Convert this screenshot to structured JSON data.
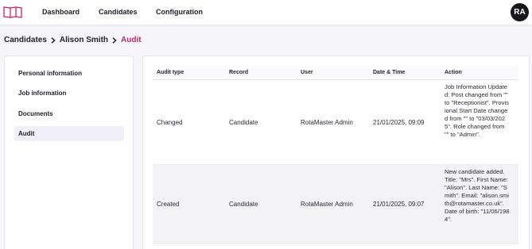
{
  "nav": {
    "items": [
      "Dashboard",
      "Candidates",
      "Configuration"
    ],
    "avatar_initials": "RA"
  },
  "breadcrumb": [
    "Candidates",
    "Alison Smith",
    "Audit"
  ],
  "sidebar": {
    "items": [
      {
        "label": "Personal information",
        "active": false
      },
      {
        "label": "Job information",
        "active": false
      },
      {
        "label": "Documents",
        "active": false
      },
      {
        "label": "Audit",
        "active": true
      }
    ]
  },
  "audit_table": {
    "headers": [
      "Audit type",
      "Record",
      "User",
      "Date & Time",
      "Action"
    ],
    "rows": [
      {
        "type": "Changed",
        "record": "Candidate",
        "user": "RotaMaster Admin",
        "datetime": "21/01/2025, 09:09",
        "action": "Job Information Updated: Post changed from \"\" to \"Receptionist\". Provisional Start Date changed from \"\" to \"03/03/2025\". Role changed from \"\" to \"Admin\"."
      },
      {
        "type": "Created",
        "record": "Candidate",
        "user": "RotaMaster Admin",
        "datetime": "21/01/2025, 09:07",
        "action": "New candidate added. Title: \"Mrs\". First Name: \"Alison\". Last Name: \"Smith\". Email: \"alison.smith@rotamaster.co.uk\". Date of birth: \"11/06/1984\"."
      }
    ]
  },
  "colors": {
    "accent": "#c8246c",
    "active_bg": "#f1eff7",
    "avatar_bg": "#17171b",
    "logo": "#c8246c"
  }
}
